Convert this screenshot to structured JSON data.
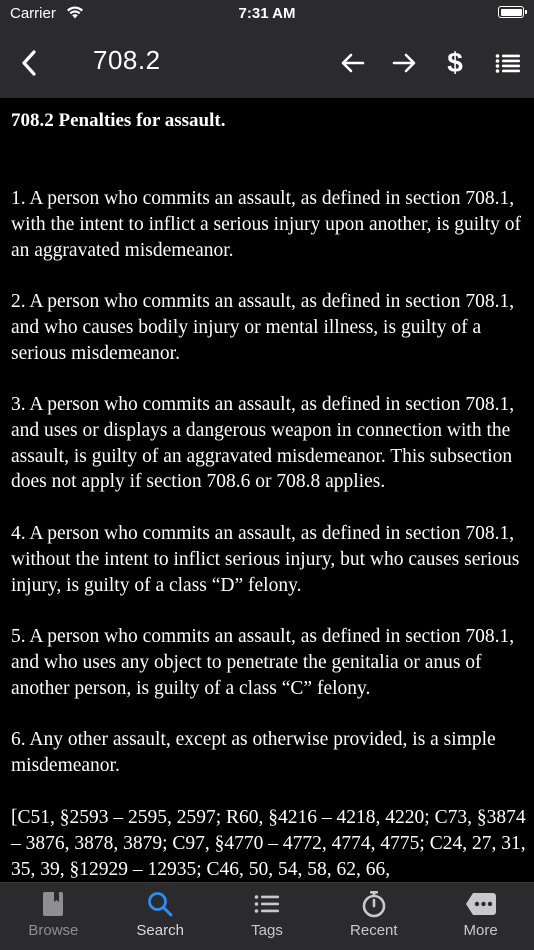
{
  "status_bar": {
    "carrier": "Carrier",
    "time": "7:31 AM"
  },
  "nav": {
    "title": "708.2",
    "icons": [
      "back-chevron-icon",
      "arrow-left-icon",
      "arrow-right-icon",
      "dollar-icon",
      "list-icon"
    ],
    "dollar_label": "$"
  },
  "content": {
    "heading": "708.2  Penalties for assault.",
    "paragraphs": [
      "1.  A person who commits an assault, as defined in section 708.1, with the intent to inflict a serious injury upon another, is guilty of an aggravated misdemeanor.",
      "2.  A person who commits an assault, as defined in section 708.1, and who causes bodily injury or mental illness, is guilty of a serious misdemeanor.",
      "3.  A person who commits an assault, as defined in section 708.1, and uses or displays a dangerous weapon in connection with the assault, is guilty of an aggravated misdemeanor. This subsection does not apply if section 708.6 or 708.8 applies.",
      "4.  A person who commits an assault, as defined in section 708.1, without the intent to inflict serious injury, but who causes serious injury, is guilty of a class “D” felony.",
      "5.  A person who commits an assault, as defined in section 708.1, and who uses any object to penetrate the genitalia or anus of another person, is guilty of a class “C” felony.",
      "6.  Any other assault, except as otherwise provided, is a simple misdemeanor.",
      "[C51, §2593 – 2595, 2597; R60, §4216 – 4218, 4220; C73, §3874 – 3876, 3878, 3879; C97, §4770 – 4772, 4774, 4775; C24, 27, 31, 35, 39, §12929 – 12935; C46, 50, 54, 58, 62, 66,"
    ]
  },
  "tabs": [
    {
      "label": "Browse",
      "icon": "book-icon"
    },
    {
      "label": "Search",
      "icon": "search-icon"
    },
    {
      "label": "Tags",
      "icon": "list-icon"
    },
    {
      "label": "Recent",
      "icon": "stopwatch-icon"
    },
    {
      "label": "More",
      "icon": "more-icon"
    }
  ],
  "colors": {
    "background": "#000000",
    "bar_background": "#2b2b2d",
    "active_tab": "#2f8cf0",
    "inactive_tab_icon": "#c9c9cc",
    "browse_tab_icon": "#8e8e93"
  }
}
